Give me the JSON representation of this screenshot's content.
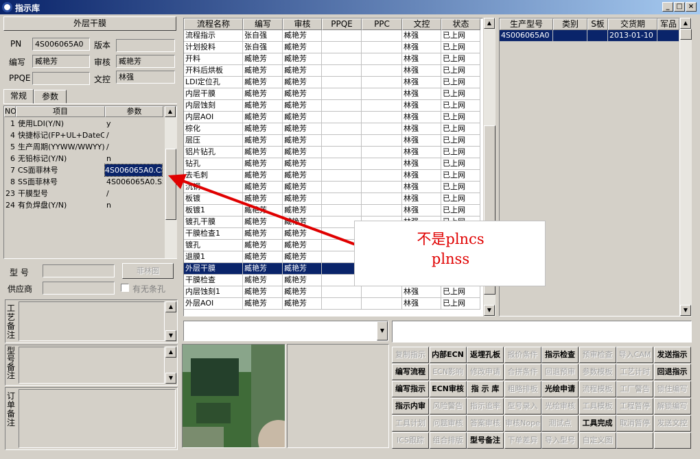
{
  "window": {
    "title": "指示库"
  },
  "left": {
    "header": "外层干膜",
    "pn_label": "PN",
    "pn_value": "4S006065A0",
    "version_label": "版本",
    "version_value": "",
    "writer_label": "编写",
    "writer_value": "臧艳芳",
    "reviewer_label": "审核",
    "reviewer_value": "臧艳芳",
    "ppqe_label": "PPQE",
    "ppqe_value": "",
    "control_label": "文控",
    "control_value": "林强",
    "tabs": [
      "常规",
      "参数"
    ],
    "param_headers": {
      "no": "NO",
      "item": "项目",
      "param": "参数"
    },
    "params": [
      {
        "no": "1",
        "item": "使用LDI(Y/N)",
        "value": "y"
      },
      {
        "no": "4",
        "item": "快捷标记(FP+UL+DateC",
        "value": "/"
      },
      {
        "no": "5",
        "item": "生产周期(YYWW/WWYY)",
        "value": "/"
      },
      {
        "no": "6",
        "item": "无铅标记(Y/N)",
        "value": "n"
      },
      {
        "no": "7",
        "item": "CS面菲林号",
        "value": "4S006065A0.CS"
      },
      {
        "no": "8",
        "item": "SS面菲林号",
        "value": "4S006065A0.SS"
      },
      {
        "no": "23",
        "item": "干膜型号",
        "value": "/"
      },
      {
        "no": "24",
        "item": "有负焊盘(Y/N)",
        "value": "n"
      }
    ],
    "model_label": "型  号",
    "film_button": "菲林图",
    "supplier_label": "供应商",
    "sticker_checkbox": "有无条孔",
    "process_note_label": "工艺备注",
    "model_note_label": "型号备注",
    "order_note_label": "订单备注"
  },
  "middle": {
    "headers": [
      "流程名称",
      "编写",
      "审核",
      "PPQE",
      "PPC",
      "文控",
      "状态"
    ],
    "rows": [
      [
        "流程指示",
        "张自强",
        "臧艳芳",
        "",
        "",
        "林强",
        "已上网"
      ],
      [
        "计划投料",
        "张自强",
        "臧艳芳",
        "",
        "",
        "林强",
        "已上网"
      ],
      [
        "开料",
        "臧艳芳",
        "臧艳芳",
        "",
        "",
        "林强",
        "已上网"
      ],
      [
        "开料后烘板",
        "臧艳芳",
        "臧艳芳",
        "",
        "",
        "林强",
        "已上网"
      ],
      [
        "LDI定位孔",
        "臧艳芳",
        "臧艳芳",
        "",
        "",
        "林强",
        "已上网"
      ],
      [
        "内层干膜",
        "臧艳芳",
        "臧艳芳",
        "",
        "",
        "林强",
        "已上网"
      ],
      [
        "内层蚀刻",
        "臧艳芳",
        "臧艳芳",
        "",
        "",
        "林强",
        "已上网"
      ],
      [
        "内层AOI",
        "臧艳芳",
        "臧艳芳",
        "",
        "",
        "林强",
        "已上网"
      ],
      [
        "棕化",
        "臧艳芳",
        "臧艳芳",
        "",
        "",
        "林强",
        "已上网"
      ],
      [
        "层压",
        "臧艳芳",
        "臧艳芳",
        "",
        "",
        "林强",
        "已上网"
      ],
      [
        "铝片钻孔",
        "臧艳芳",
        "臧艳芳",
        "",
        "",
        "林强",
        "已上网"
      ],
      [
        "钻孔",
        "臧艳芳",
        "臧艳芳",
        "",
        "",
        "林强",
        "已上网"
      ],
      [
        "去毛刺",
        "臧艳芳",
        "臧艳芳",
        "",
        "",
        "林强",
        "已上网"
      ],
      [
        "沉铜",
        "臧艳芳",
        "臧艳芳",
        "",
        "",
        "林强",
        "已上网"
      ],
      [
        "板镀",
        "臧艳芳",
        "臧艳芳",
        "",
        "",
        "林强",
        "已上网"
      ],
      [
        "板镀1",
        "臧艳芳",
        "臧艳芳",
        "",
        "",
        "林强",
        "已上网"
      ],
      [
        "镀孔干膜",
        "臧艳芳",
        "臧艳芳",
        "",
        "",
        "林强",
        "已上网"
      ],
      [
        "干膜检查1",
        "臧艳芳",
        "臧艳芳",
        "",
        "",
        "林强",
        "已上网"
      ],
      [
        "镀孔",
        "臧艳芳",
        "臧艳芳",
        "",
        "",
        "林强",
        "已上网"
      ],
      [
        "退膜1",
        "臧艳芳",
        "臧艳芳",
        "",
        "",
        "林强",
        "已上网"
      ],
      [
        "外层干膜",
        "臧艳芳",
        "臧艳芳",
        "",
        "",
        "",
        ""
      ],
      [
        "干膜检查",
        "臧艳芳",
        "臧艳芳",
        "",
        "",
        "",
        ""
      ],
      [
        "内层蚀刻1",
        "臧艳芳",
        "臧艳芳",
        "",
        "",
        "林强",
        "已上网"
      ],
      [
        "外层AOI",
        "臧艳芳",
        "臧艳芳",
        "",
        "",
        "林强",
        "已上网"
      ]
    ],
    "selected_row": 20
  },
  "right": {
    "headers": [
      "生产型号",
      "类别",
      "S板",
      "交货期",
      "军品"
    ],
    "rows": [
      [
        "4S006065A0",
        "",
        "",
        "2013-01-10",
        ""
      ]
    ]
  },
  "callout": {
    "line1": "不是plncs",
    "line2": "plnss",
    "color": "#e00000"
  },
  "buttons": [
    [
      "复制指示",
      "内部ECN",
      "返埋孔板",
      "报价条件",
      "指示检查",
      "预审检查",
      "导入CAM",
      "发送指示"
    ],
    [
      "编写流程",
      "ECN影响",
      "修改申请",
      "合拼条件",
      "回退预审",
      "参数模板",
      "工艺计时",
      "回退指示"
    ],
    [
      "编写指示",
      "ECN审核",
      "指 示 库",
      "粗略排板",
      "光绘申请",
      "流程模板",
      "工厂警告",
      "锁住编写"
    ],
    [
      "指示内审",
      "风险警告",
      "指示追率",
      "型号录入",
      "光绘审核",
      "工具模板",
      "工程暂停",
      "解锁编写"
    ],
    [
      "工具计划",
      "问题审核",
      "答案审核",
      "审核Nope",
      "测试点",
      "工具完成",
      "取消暂停",
      "发送文控"
    ],
    [
      "ICS跟踪",
      "组合排版",
      "型号备注",
      "下单差异",
      "导入型号",
      "自定义图",
      "",
      ""
    ]
  ]
}
